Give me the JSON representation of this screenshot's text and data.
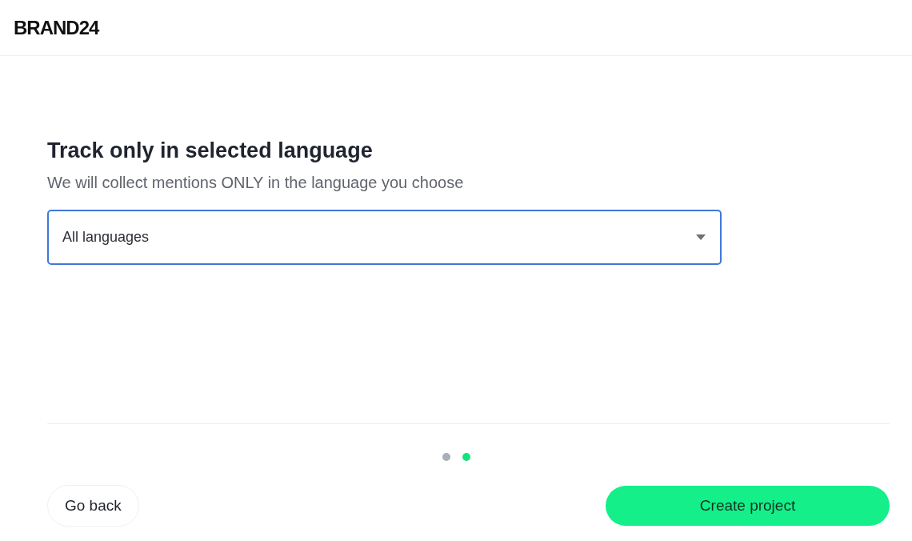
{
  "header": {
    "logo": "BRAND24"
  },
  "step": {
    "title": "Track only in selected language",
    "subtitle": "We will collect mentions ONLY in the language you choose"
  },
  "language_select": {
    "value": "All languages",
    "focused": true
  },
  "steps": [
    {
      "selected": false
    },
    {
      "selected": true
    }
  ],
  "buttons": {
    "back": "Go back",
    "primary": "Create project"
  }
}
